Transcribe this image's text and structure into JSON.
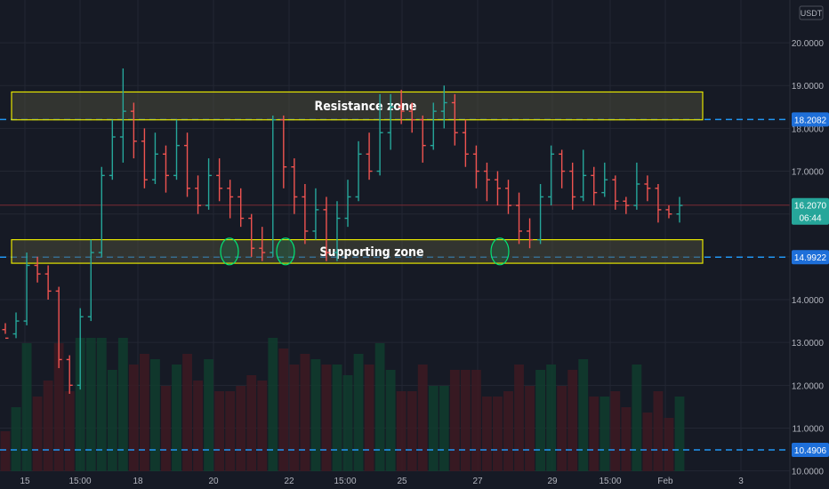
{
  "colors": {
    "background": "#161a25",
    "grid": "#232733",
    "up": "#26a69a",
    "down": "#ef5350",
    "volume_up": "#0f3d2e",
    "volume_down": "#3d1a22",
    "zone_stroke": "#e6e600",
    "zone_fill": "#4a4a3a",
    "dashed_level": "#2196f3",
    "axis_text": "#b2b5be",
    "label_bg": "#1e6fd9",
    "current_bg": "#26a69a",
    "circle": "#00e676",
    "current_line": "#7a2b34"
  },
  "chart_data": {
    "type": "ohlc",
    "currency": "USDT",
    "ylim": [
      10.2,
      20.5
    ],
    "y_ticks": [
      "20.0000",
      "19.0000",
      "18.0000",
      "17.0000",
      "16.0000",
      "15.0000",
      "14.0000",
      "13.0000",
      "12.0000",
      "11.0000",
      "10.0000"
    ],
    "x_ticks": [
      "15",
      "15:00",
      "18",
      "20",
      "22",
      "15:00",
      "25",
      "27",
      "29",
      "15:00",
      "Feb",
      "3"
    ],
    "levels": [
      {
        "label": "18.2082",
        "value": 18.2082
      },
      {
        "label": "14.9922",
        "value": 14.9922
      },
      {
        "label": "10.4906",
        "value": 10.4906
      }
    ],
    "current_price": {
      "label": "16.2070",
      "value": 16.207,
      "countdown": "06:44"
    },
    "zones": [
      {
        "name": "Resistance zone",
        "y_low": 18.2,
        "y_high": 18.85
      },
      {
        "name": "Supporting zone",
        "y_low": 14.85,
        "y_high": 15.4
      }
    ],
    "bars": [
      [
        13.3,
        13.1,
        13.45,
        13.2
      ],
      [
        13.2,
        13.5,
        13.7,
        13.1
      ],
      [
        13.5,
        14.8,
        15.1,
        13.4
      ],
      [
        14.8,
        14.6,
        15.0,
        14.4
      ],
      [
        14.6,
        14.2,
        14.8,
        14.0
      ],
      [
        14.2,
        12.6,
        14.3,
        12.4
      ],
      [
        12.6,
        12.0,
        12.7,
        11.8
      ],
      [
        12.0,
        13.6,
        13.8,
        11.9
      ],
      [
        13.6,
        15.1,
        15.4,
        13.5
      ],
      [
        15.1,
        16.9,
        17.1,
        15.0
      ],
      [
        16.9,
        17.8,
        18.2,
        16.8
      ],
      [
        17.8,
        18.4,
        19.4,
        17.2
      ],
      [
        18.4,
        17.7,
        18.6,
        17.3
      ],
      [
        17.7,
        16.8,
        18.0,
        16.6
      ],
      [
        16.8,
        17.4,
        17.9,
        16.7
      ],
      [
        17.4,
        16.9,
        17.6,
        16.5
      ],
      [
        16.9,
        17.6,
        18.2,
        16.8
      ],
      [
        17.6,
        16.6,
        17.9,
        16.4
      ],
      [
        16.6,
        16.2,
        16.9,
        16.0
      ],
      [
        16.2,
        16.9,
        17.3,
        16.1
      ],
      [
        16.9,
        16.6,
        17.3,
        16.3
      ],
      [
        16.6,
        16.4,
        16.8,
        15.9
      ],
      [
        16.4,
        15.9,
        16.6,
        15.7
      ],
      [
        15.9,
        15.2,
        16.0,
        15.0
      ],
      [
        15.2,
        15.1,
        15.7,
        14.9
      ],
      [
        15.1,
        18.2,
        18.3,
        15.0
      ],
      [
        18.2,
        17.1,
        18.3,
        16.6
      ],
      [
        17.1,
        16.4,
        17.3,
        16.0
      ],
      [
        16.4,
        15.6,
        16.7,
        15.3
      ],
      [
        15.6,
        16.1,
        16.6,
        15.4
      ],
      [
        16.1,
        15.1,
        16.4,
        14.9
      ],
      [
        15.1,
        15.9,
        16.3,
        14.9
      ],
      [
        15.9,
        16.4,
        16.8,
        15.7
      ],
      [
        16.4,
        17.4,
        17.7,
        16.3
      ],
      [
        17.4,
        17.0,
        17.9,
        16.8
      ],
      [
        17.0,
        17.9,
        18.8,
        16.9
      ],
      [
        17.9,
        18.5,
        18.8,
        17.5
      ],
      [
        18.5,
        18.4,
        18.9,
        18.1
      ],
      [
        18.4,
        18.2,
        18.6,
        17.9
      ],
      [
        18.2,
        17.6,
        18.3,
        17.2
      ],
      [
        17.6,
        18.4,
        18.6,
        17.5
      ],
      [
        18.4,
        18.6,
        19.0,
        18.0
      ],
      [
        18.6,
        17.9,
        18.8,
        17.6
      ],
      [
        17.9,
        17.4,
        18.2,
        17.1
      ],
      [
        17.4,
        17.0,
        17.6,
        16.6
      ],
      [
        17.0,
        16.8,
        17.2,
        16.3
      ],
      [
        16.8,
        16.6,
        17.0,
        16.2
      ],
      [
        16.6,
        16.2,
        16.8,
        16.0
      ],
      [
        16.2,
        15.6,
        16.5,
        15.3
      ],
      [
        15.6,
        15.4,
        15.9,
        15.2
      ],
      [
        15.4,
        16.4,
        16.7,
        15.3
      ],
      [
        16.4,
        17.4,
        17.6,
        16.2
      ],
      [
        17.4,
        17.0,
        17.5,
        16.6
      ],
      [
        17.0,
        16.4,
        17.2,
        16.1
      ],
      [
        16.4,
        16.9,
        17.5,
        16.3
      ],
      [
        16.9,
        16.5,
        17.1,
        16.2
      ],
      [
        16.5,
        16.8,
        17.2,
        16.4
      ],
      [
        16.8,
        16.3,
        16.9,
        16.1
      ],
      [
        16.3,
        16.2,
        16.4,
        16.0
      ],
      [
        16.2,
        16.7,
        17.2,
        16.1
      ],
      [
        16.7,
        16.6,
        16.9,
        16.3
      ],
      [
        16.6,
        16.1,
        16.7,
        15.8
      ],
      [
        16.1,
        16.0,
        16.2,
        15.9
      ],
      [
        16.0,
        16.2,
        16.4,
        15.8
      ]
    ]
  }
}
